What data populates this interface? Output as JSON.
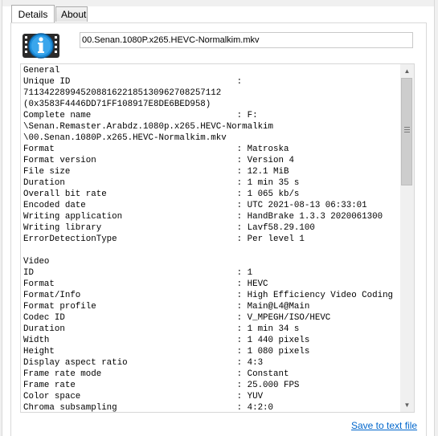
{
  "tabs": [
    {
      "label": "Details"
    },
    {
      "label": "About"
    }
  ],
  "filename": "00.Senan.1080P.x265.HEVC-Normalkim.mkv",
  "report_lines": [
    "General",
    "Unique ID                                :",
    "71134228994520881622185130962708257112",
    "(0x3583F4446DD71FF108917E8DE6BED958)",
    "Complete name                            : F:",
    "\\Senan.Remaster.Arabdz.1080p.x265.HEVC-Normalkim",
    "\\00.Senan.1080P.x265.HEVC-Normalkim.mkv",
    "Format                                   : Matroska",
    "Format version                           : Version 4",
    "File size                                : 12.1 MiB",
    "Duration                                 : 1 min 35 s",
    "Overall bit rate                         : 1 065 kb/s",
    "Encoded date                             : UTC 2021-08-13 06:33:01",
    "Writing application                      : HandBrake 1.3.3 2020061300",
    "Writing library                          : Lavf58.29.100",
    "ErrorDetectionType                       : Per level 1",
    "",
    "Video",
    "ID                                       : 1",
    "Format                                   : HEVC",
    "Format/Info                              : High Efficiency Video Coding",
    "Format profile                           : Main@L4@Main",
    "Codec ID                                 : V_MPEGH/ISO/HEVC",
    "Duration                                 : 1 min 34 s",
    "Width                                    : 1 440 pixels",
    "Height                                   : 1 080 pixels",
    "Display aspect ratio                     : 4:3",
    "Frame rate mode                          : Constant",
    "Frame rate                               : 25.000 FPS",
    "Color space                              : YUV",
    "Chroma subsampling                       : 4:2:0"
  ],
  "save_link": "Save to text file",
  "scrollbar": {
    "position_fraction": 0.0
  },
  "colors": {
    "link": "#0066cc",
    "icon_blue": "#1e8fdc"
  }
}
